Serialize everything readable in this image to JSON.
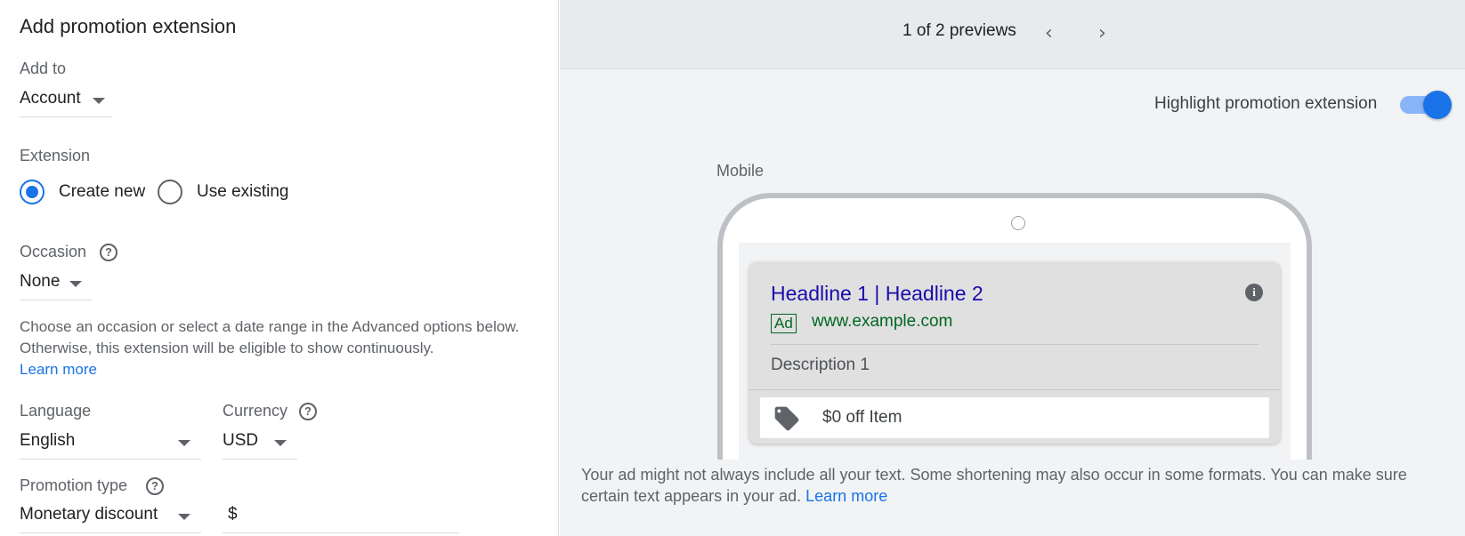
{
  "form": {
    "title": "Add promotion extension",
    "add_to": {
      "label": "Add to",
      "value": "Account"
    },
    "extension": {
      "label": "Extension",
      "options": [
        "Create new",
        "Use existing"
      ],
      "selected": "Create new"
    },
    "occasion": {
      "label": "Occasion",
      "value": "None",
      "help_text": "Choose an occasion or select a date range in the Advanced options below. Otherwise, this extension will be eligible to show continuously.",
      "learn_more": "Learn more"
    },
    "language": {
      "label": "Language",
      "value": "English"
    },
    "currency": {
      "label": "Currency",
      "value": "USD"
    },
    "promotion_type": {
      "label": "Promotion type",
      "value": "Monetary discount"
    },
    "amount": {
      "prefix": "$"
    }
  },
  "preview": {
    "counter": "1 of 2 previews",
    "highlight_label": "Highlight promotion extension",
    "highlight_on": true,
    "device_label": "Mobile",
    "ad": {
      "headline": "Headline 1 | Headline 2",
      "badge": "Ad",
      "url": "www.example.com",
      "description": "Description 1",
      "promotion": "$0 off Item"
    },
    "footer_text": "Your ad might not always include all your text. Some shortening may also occur in some formats. You can make sure certain text appears in your ad.",
    "footer_link": "Learn more"
  },
  "colors": {
    "accent": "#1a73e8",
    "headline": "#1a0dab",
    "url": "#006621"
  }
}
